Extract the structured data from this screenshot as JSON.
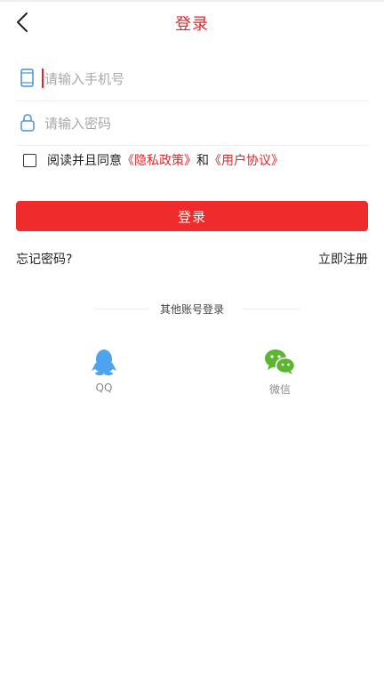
{
  "header": {
    "title": "登录"
  },
  "phone_field": {
    "placeholder": "请输入手机号",
    "value": ""
  },
  "password_field": {
    "placeholder": "请输入密码",
    "value": ""
  },
  "agreement": {
    "prefix": "阅读并且同意",
    "privacy_link": "《隐私政策》",
    "connector": "和",
    "terms_link": "《用户协议》",
    "checked": false
  },
  "login_button": {
    "label": "登录"
  },
  "links": {
    "forgot_password": "忘记密码?",
    "register": "立即注册"
  },
  "other_login": {
    "title": "其他账号登录",
    "options": [
      {
        "label": "QQ",
        "icon": "qq-icon"
      },
      {
        "label": "微信",
        "icon": "wechat-icon"
      }
    ]
  },
  "colors": {
    "accent": "#e0282a",
    "button": "#f02b2b",
    "input_icon": "#4a90d9",
    "qq": "#4da3ee",
    "wechat": "#5bb531"
  }
}
